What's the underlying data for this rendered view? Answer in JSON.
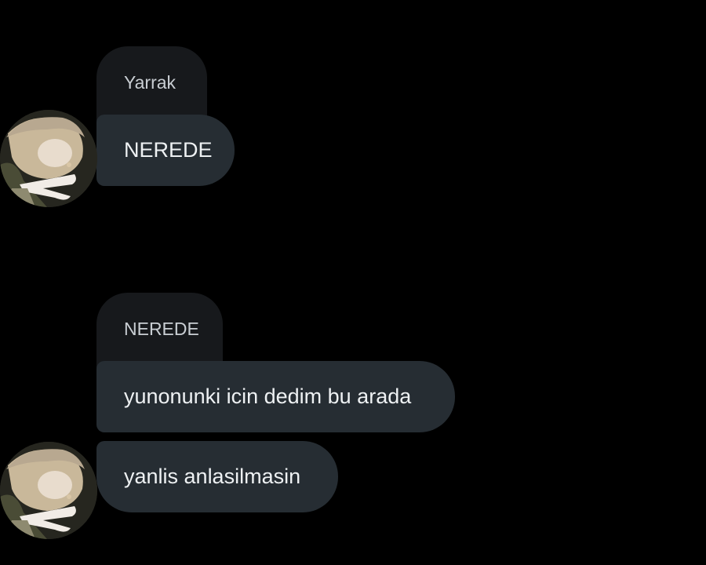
{
  "messages": {
    "first_group": {
      "reply_quote": "Yarrak",
      "bubble_text": "NEREDE"
    },
    "second_group": {
      "reply_quote": "NEREDE",
      "bubble_1_text": "yunonunki icin dedim bu arada",
      "bubble_2_text": "yanlis anlasilmasin"
    }
  },
  "colors": {
    "background": "#000000",
    "bubble": "#262d33",
    "reply_quote": "#17191c",
    "text_primary": "#eef1f3",
    "text_quote": "#c9ced3"
  },
  "icons": {
    "avatar": "contact-avatar-photo"
  }
}
